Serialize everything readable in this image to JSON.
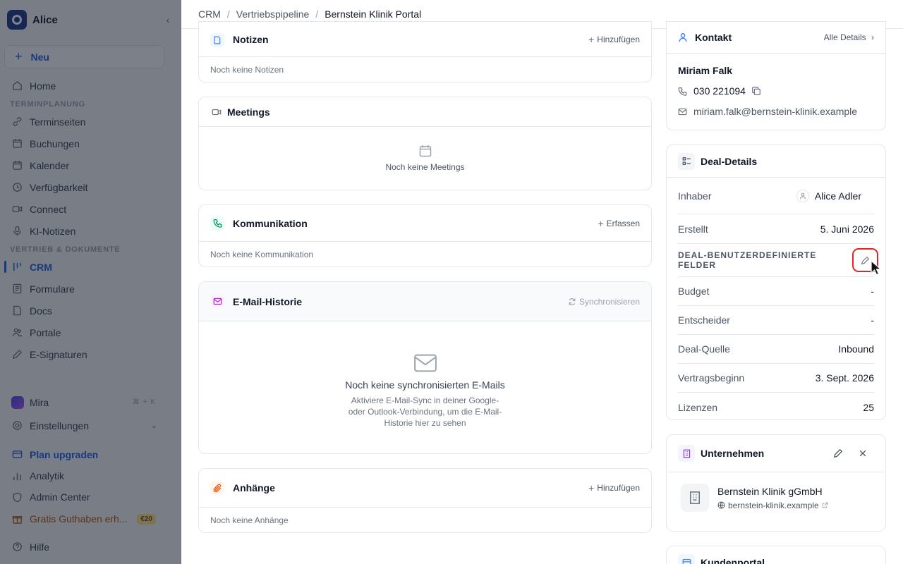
{
  "sidebar": {
    "workspace": "Alice",
    "new_label": "Neu",
    "home": "Home",
    "section_scheduling": "TERMINPLANUNG",
    "scheduling_items": [
      "Terminseiten",
      "Buchungen",
      "Kalender",
      "Verfügbarkeit",
      "Connect",
      "KI-Notizen"
    ],
    "section_sales": "VERTRIEB & DOKUMENTE",
    "sales_items": [
      "CRM",
      "Formulare",
      "Docs",
      "Portale",
      "E-Signaturen"
    ],
    "mira": "Mira",
    "mira_shortcut": "⌘ + K",
    "settings": "Einstellungen",
    "upgrade": "Plan upgraden",
    "analytics": "Analytik",
    "admin": "Admin Center",
    "credit": "Gratis Guthaben erh...",
    "credit_badge": "€20",
    "help": "Hilfe"
  },
  "breadcrumb": {
    "items": [
      "CRM",
      "Vertriebspipeline"
    ],
    "current": "Bernstein Klinik Portal"
  },
  "notes": {
    "title": "Notizen",
    "action": "Hinzufügen",
    "empty": "Noch keine Notizen"
  },
  "meetings": {
    "title": "Meetings",
    "empty": "Noch keine Meetings"
  },
  "communication": {
    "title": "Kommunikation",
    "action": "Erfassen",
    "empty": "Noch keine Kommunikation"
  },
  "email": {
    "title": "E-Mail-Historie",
    "action": "Synchronisieren",
    "empty_title": "Noch keine synchronisierten E-Mails",
    "empty_text": "Aktiviere E-Mail-Sync in deiner Google- oder Outlook-Verbindung, um die E-Mail-Historie hier zu sehen"
  },
  "attachments": {
    "title": "Anhänge",
    "action": "Hinzufügen",
    "empty": "Noch keine Anhänge"
  },
  "contact": {
    "title": "Kontakt",
    "link": "Alle Details",
    "name": "Miriam Falk",
    "phone": "030 221094",
    "email": "miriam.falk@bernstein-klinik.example"
  },
  "deal": {
    "title": "Deal-Details",
    "owner_label": "Inhaber",
    "owner_value": "Alice Adler",
    "created_label": "Erstellt",
    "created_value": "5. Juni 2026",
    "custom_section": "DEAL-BENUTZERDEFINIERTE FELDER",
    "fields": [
      {
        "label": "Budget",
        "value": "-"
      },
      {
        "label": "Entscheider",
        "value": "-"
      },
      {
        "label": "Deal-Quelle",
        "value": "Inbound"
      },
      {
        "label": "Vertragsbeginn",
        "value": "3. Sept. 2026"
      },
      {
        "label": "Lizenzen",
        "value": "25"
      }
    ]
  },
  "company": {
    "title": "Unternehmen",
    "name": "Bernstein Klinik gGmbH",
    "domain": "bernstein-klinik.example"
  },
  "portal": {
    "title": "Kundenportal"
  },
  "colors": {
    "accent": "#2563eb",
    "highlight": "#dc2626"
  }
}
